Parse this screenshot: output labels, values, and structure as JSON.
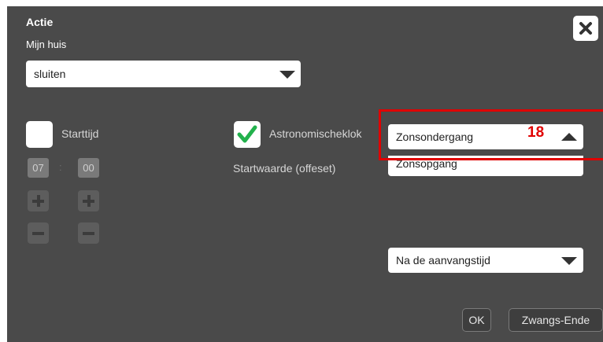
{
  "dialog": {
    "title": "Actie",
    "subtitle": "Mijn huis",
    "action_select": {
      "value": "sluiten"
    },
    "start_time": {
      "checkbox_label": "Starttijd",
      "checked": false,
      "hours": "07",
      "separator": ":",
      "minutes": "00"
    },
    "astro": {
      "checkbox_label": "Astronomischeklok",
      "checked": true,
      "offset_label": "Startwaarde (offeset)"
    },
    "astro_select": {
      "value": "Zonsondergang",
      "options": [
        "Zonsopgang"
      ]
    },
    "annotation": {
      "number": "18",
      "color": "#e00000"
    },
    "timing_select": {
      "value": "Na de aanvangstijd"
    },
    "buttons": {
      "ok": "OK",
      "force_end": "Zwangs-Ende"
    },
    "icons": {
      "close": "close-icon",
      "check": "checkmark-icon"
    },
    "colors": {
      "background": "#4a4a4a",
      "check": "#22b14c",
      "highlight": "#e00000"
    }
  }
}
